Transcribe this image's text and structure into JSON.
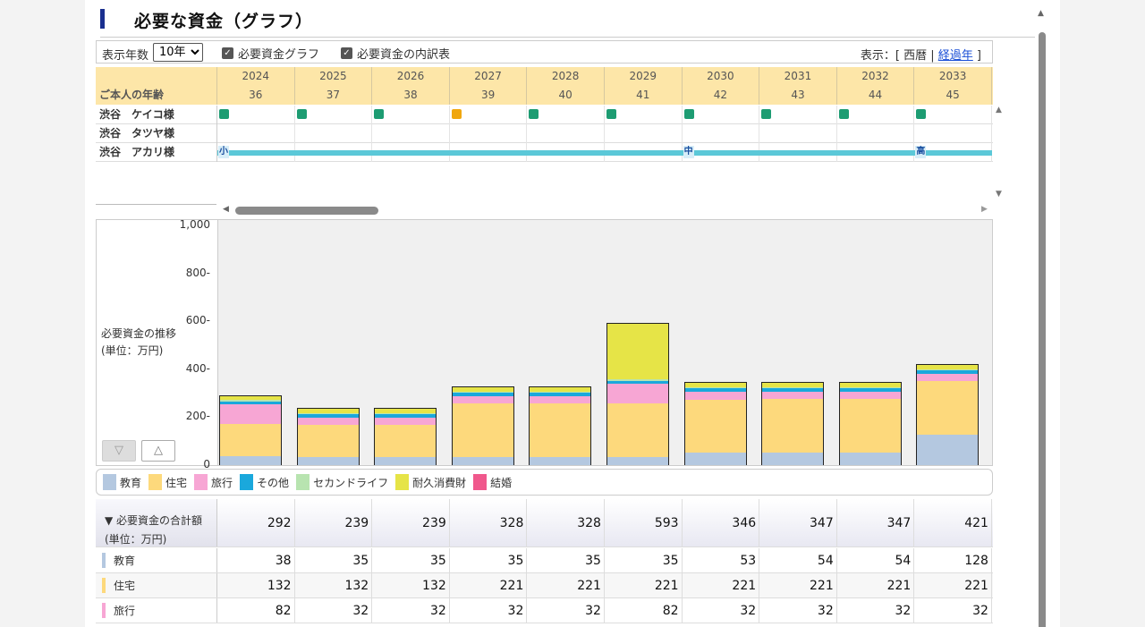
{
  "title": "必要な資金（グラフ）",
  "controls": {
    "years_label": "表示年数",
    "years_value": "10年",
    "cb_graph": "必要資金グラフ",
    "cb_table": "必要資金の内訳表",
    "display_prefix": "表示：[",
    "display_western": "西暦",
    "display_sep": "|",
    "display_elapsed": "経過年",
    "display_suffix": "]"
  },
  "timeline": {
    "age_label": "ご本人の年齢",
    "years": [
      "2024",
      "2025",
      "2026",
      "2027",
      "2028",
      "2029",
      "2030",
      "2031",
      "2032",
      "2033"
    ],
    "ages": [
      "36",
      "37",
      "38",
      "39",
      "40",
      "41",
      "42",
      "43",
      "44",
      "45"
    ],
    "people": [
      {
        "name": "渋谷　ケイコ様",
        "events": [
          "work",
          "work",
          "work",
          "home",
          "work",
          "work",
          "work",
          "work",
          "work",
          "work"
        ]
      },
      {
        "name": "渋谷　タツヤ様",
        "events": []
      },
      {
        "name": "渋谷　アカリ様",
        "events": []
      }
    ],
    "edu_tags": [
      {
        "col": 0,
        "text": "小"
      },
      {
        "col": 6,
        "text": "中"
      },
      {
        "col": 9,
        "text": "高"
      }
    ]
  },
  "chart_data": {
    "type": "bar",
    "stacked": true,
    "ylabel": "必要資金の推移\n(単位：万円)",
    "ylim": [
      0,
      1000
    ],
    "yticks": [
      "1,000",
      "800-",
      "600-",
      "400-",
      "200-",
      "0"
    ],
    "categories": [
      "2024",
      "2025",
      "2026",
      "2027",
      "2028",
      "2029",
      "2030",
      "2031",
      "2032",
      "2033"
    ],
    "series": [
      {
        "name": "教育",
        "color": "#b4c8e0",
        "values": [
          38,
          35,
          35,
          35,
          35,
          35,
          53,
          54,
          54,
          128
        ]
      },
      {
        "name": "住宅",
        "color": "#fdd97c",
        "values": [
          132,
          132,
          132,
          221,
          221,
          221,
          221,
          221,
          221,
          221
        ]
      },
      {
        "name": "旅行",
        "color": "#f7a6d4",
        "values": [
          82,
          32,
          32,
          32,
          32,
          82,
          32,
          32,
          32,
          32
        ]
      },
      {
        "name": "その他",
        "color": "#1aa8dc",
        "values": [
          14,
          14,
          14,
          14,
          14,
          14,
          14,
          14,
          14,
          14
        ]
      },
      {
        "name": "セカンドライフ",
        "color": "#b8e4b0",
        "values": [
          5,
          5,
          5,
          5,
          5,
          5,
          5,
          5,
          5,
          5
        ]
      },
      {
        "name": "耐久消費財",
        "color": "#e6e447",
        "values": [
          21,
          21,
          21,
          21,
          21,
          236,
          21,
          21,
          21,
          21
        ]
      },
      {
        "name": "結婚",
        "color": "#f0588c",
        "values": [
          0,
          0,
          0,
          0,
          0,
          0,
          0,
          0,
          0,
          0
        ]
      }
    ]
  },
  "legend": [
    {
      "label": "教育",
      "color": "#b4c8e0"
    },
    {
      "label": "住宅",
      "color": "#fdd97c"
    },
    {
      "label": "旅行",
      "color": "#f7a6d4"
    },
    {
      "label": "その他",
      "color": "#1aa8dc"
    },
    {
      "label": "セカンドライフ",
      "color": "#b8e4b0"
    },
    {
      "label": "耐久消費財",
      "color": "#e6e447"
    },
    {
      "label": "結婚",
      "color": "#f0588c"
    }
  ],
  "totals": {
    "header_line1": "▼ 必要資金の合計額",
    "header_line2": "(単位：万円)",
    "total_values": [
      "292",
      "239",
      "239",
      "328",
      "328",
      "593",
      "346",
      "347",
      "347",
      "421"
    ],
    "rows": [
      {
        "label": "教育",
        "color": "#b4c8e0",
        "values": [
          "38",
          "35",
          "35",
          "35",
          "35",
          "35",
          "53",
          "54",
          "54",
          "128"
        ]
      },
      {
        "label": "住宅",
        "color": "#fdd97c",
        "values": [
          "132",
          "132",
          "132",
          "221",
          "221",
          "221",
          "221",
          "221",
          "221",
          "221"
        ]
      },
      {
        "label": "旅行",
        "color": "#f7a6d4",
        "values": [
          "82",
          "32",
          "32",
          "32",
          "32",
          "82",
          "32",
          "32",
          "32",
          "32"
        ]
      }
    ]
  }
}
